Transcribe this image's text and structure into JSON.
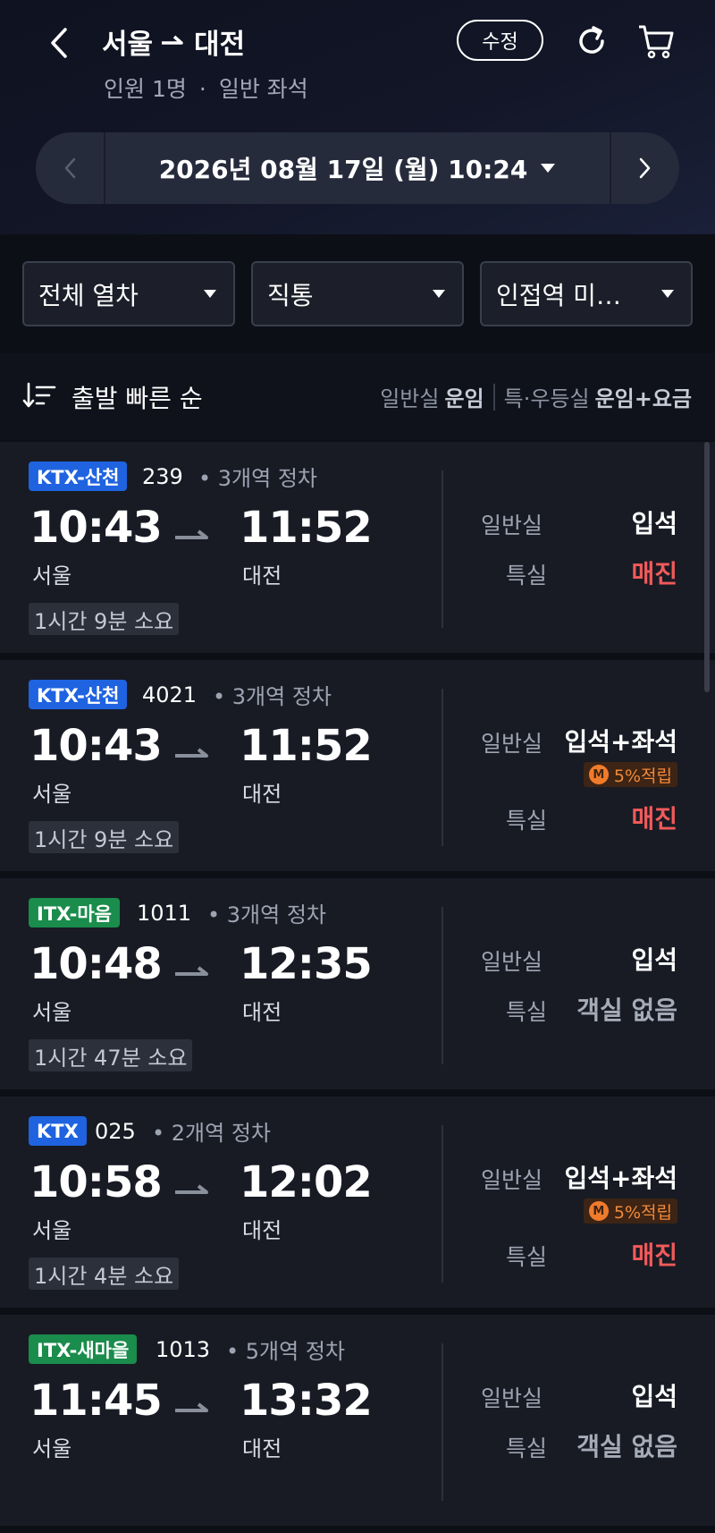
{
  "header": {
    "origin": "서울",
    "destination": "대전",
    "passengers": "인원 1명",
    "separator": "·",
    "seat_class": "일반 좌석",
    "edit_label": "수정"
  },
  "date_bar": {
    "date_text": "2026년 08월 17일 (월) 10:24"
  },
  "filters": [
    {
      "label": "전체 열차"
    },
    {
      "label": "직통"
    },
    {
      "label": "인접역 미…"
    }
  ],
  "sort": {
    "label": "출발 빠른 순",
    "general_prefix": "일반실",
    "general_bold": "운임",
    "special_prefix": "특·우등실",
    "special_bold": "운임+요금"
  },
  "trains": [
    {
      "type": "KTX-산천",
      "badge_color": "#1f63e0",
      "number": "239",
      "stops": "• 3개역 정차",
      "dep_time": "10:43",
      "arr_time": "11:52",
      "dep_station": "서울",
      "arr_station": "대전",
      "duration": "1시간 9분 소요",
      "general_label": "일반실",
      "general_status": "입석",
      "special_label": "특실",
      "special_status": "매진"
    },
    {
      "type": "KTX-산천",
      "badge_color": "#1f63e0",
      "number": "4021",
      "stops": "• 3개역 정차",
      "dep_time": "10:43",
      "arr_time": "11:52",
      "dep_station": "서울",
      "arr_station": "대전",
      "duration": "1시간 9분 소요",
      "general_label": "일반실",
      "general_status": "입석+좌석",
      "reward_icon": "M",
      "reward": "5%적립",
      "special_label": "특실",
      "special_status": "매진"
    },
    {
      "type": "ITX-마음",
      "badge_color": "#1a8c4c",
      "number": "1011",
      "stops": "• 3개역 정차",
      "dep_time": "10:48",
      "arr_time": "12:35",
      "dep_station": "서울",
      "arr_station": "대전",
      "duration": "1시간 47분 소요",
      "general_label": "일반실",
      "general_status": "입석",
      "special_label": "특실",
      "special_status": "객실 없음"
    },
    {
      "type": "KTX",
      "badge_color": "#1f63e0",
      "number": "025",
      "stops": "• 2개역 정차",
      "dep_time": "10:58",
      "arr_time": "12:02",
      "dep_station": "서울",
      "arr_station": "대전",
      "duration": "1시간 4분 소요",
      "general_label": "일반실",
      "general_status": "입석+좌석",
      "reward_icon": "M",
      "reward": "5%적립",
      "special_label": "특실",
      "special_status": "매진"
    },
    {
      "type": "ITX-새마을",
      "badge_color": "#1a8c4c",
      "number": "1013",
      "stops": "• 5개역 정차",
      "dep_time": "11:45",
      "arr_time": "13:32",
      "dep_station": "서울",
      "arr_station": "대전",
      "general_label": "일반실",
      "general_status": "입석",
      "special_label": "특실",
      "special_status": "객실 없음"
    }
  ],
  "icons": {
    "back": "chevron-left-icon",
    "route_arrow": "arrow-right-icon",
    "refresh": "refresh-icon",
    "cart": "cart-icon",
    "prev_date": "chevron-left-icon",
    "next_date": "chevron-right-icon",
    "caret": "caret-down-icon",
    "sort": "sort-icon"
  },
  "colors": {
    "background": "#0d0f16",
    "card": "#181b24",
    "ktx_badge": "#1f63e0",
    "itx_badge": "#1a8c4c",
    "sold_out": "#f25a5a",
    "reward": "#f28a3a"
  }
}
